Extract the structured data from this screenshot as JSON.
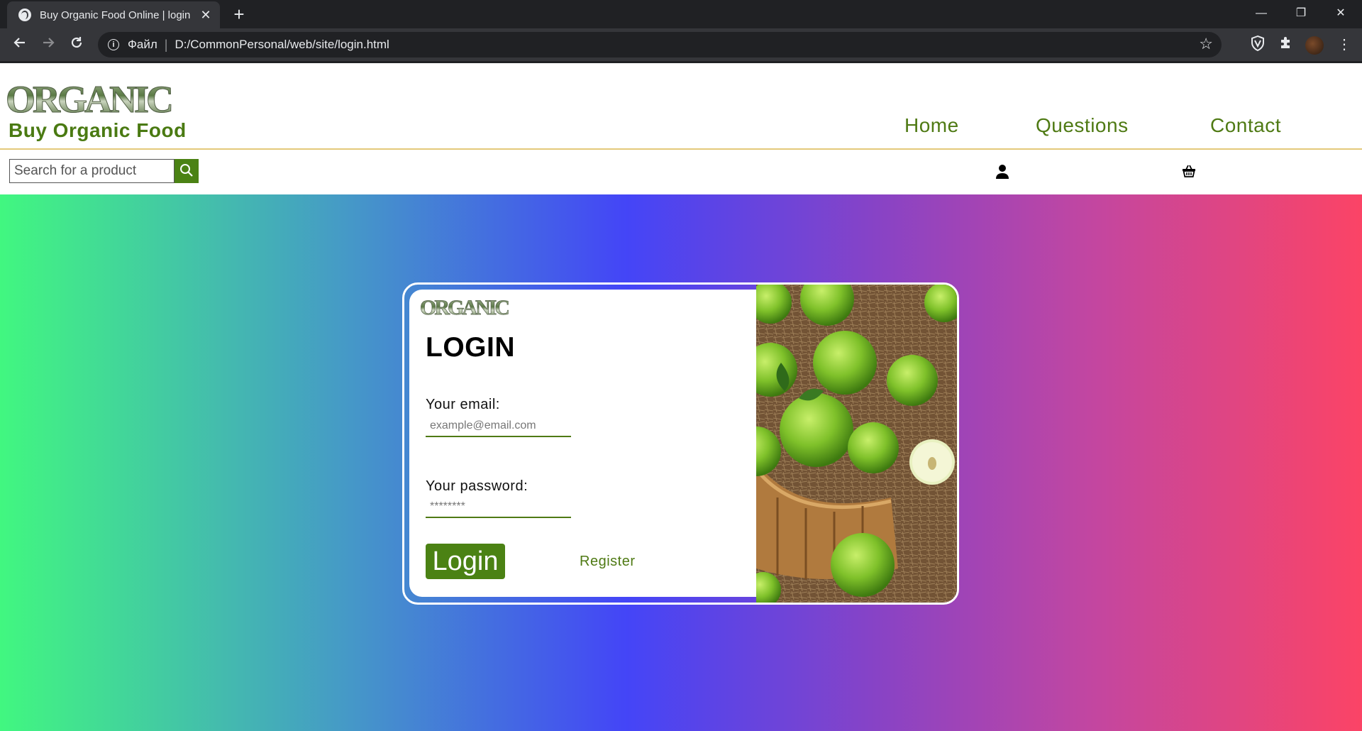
{
  "browser": {
    "tab_title": "Buy Organic Food Online | login",
    "tab_close": "✕",
    "new_tab": "+",
    "address_scheme": "Файл",
    "address_sep": "|",
    "address_url": "D:/CommonPersonal/web/site/login.html",
    "window_controls": {
      "minimize": "—",
      "restore": "❐",
      "close": "✕"
    }
  },
  "site": {
    "logo_text": "ORGANIC",
    "tagline": "Buy Organic Food",
    "nav": {
      "home": "Home",
      "questions": "Questions",
      "contact": "Contact"
    },
    "search_placeholder": "Search for a product",
    "icons": {
      "search": "search-icon",
      "user": "user-icon",
      "cart": "basket-icon"
    }
  },
  "login_card": {
    "logo_text": "ORGANIC",
    "title": "LOGIN",
    "email_label": "Your email:",
    "email_placeholder": "example@email.com",
    "password_label": "Your password:",
    "password_placeholder": "********",
    "login_button": "Login",
    "register_link": "Register"
  },
  "colors": {
    "brand_green": "#4b8214",
    "header_rule": "#e4c97a",
    "gradient": [
      "#41f780",
      "#459bc6",
      "#4445f7",
      "#8a43c4",
      "#c246a1",
      "#fb4466"
    ]
  }
}
